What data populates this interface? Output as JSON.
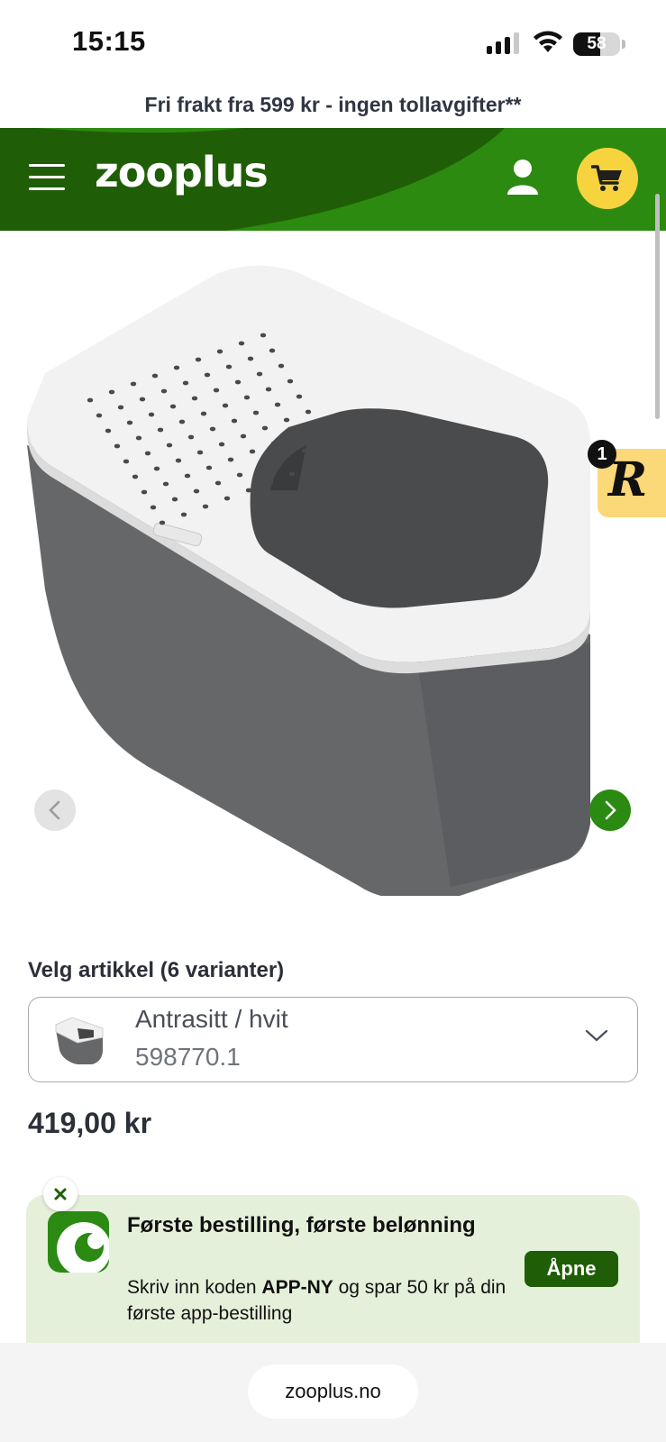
{
  "status_bar": {
    "time": "15:15",
    "battery": "58",
    "battery_level": 0.58,
    "icons": [
      "cellular-signal-icon",
      "wifi-icon",
      "battery-icon"
    ]
  },
  "promo": {
    "text": "Fri frakt fra 599 kr - ingen tollavgifter**"
  },
  "header": {
    "logo": "zooplus",
    "icons": [
      "hamburger-menu-icon",
      "user-icon",
      "shopping-cart-icon"
    ],
    "colors": {
      "header_bg": "#1f5e06",
      "cart_bg": "#f7d33e"
    }
  },
  "gallery": {
    "icons": [
      "chevron-left-icon",
      "chevron-right-icon"
    ]
  },
  "rewards": {
    "badge_count": "1",
    "logo_letter": "R"
  },
  "variant": {
    "label": "Velg artikkel (6 varianter)",
    "selected_name": "Antrasitt / hvit",
    "selected_sku": "598770.1"
  },
  "price": "419,00 kr",
  "app_banner": {
    "title": "Første bestilling, første belønning",
    "text_before": "Skriv inn koden ",
    "code": "APP-NY",
    "text_after": " og spar 50 kr på din første app-bestilling",
    "button": "Åpne"
  },
  "browser": {
    "url": "zooplus.no"
  }
}
